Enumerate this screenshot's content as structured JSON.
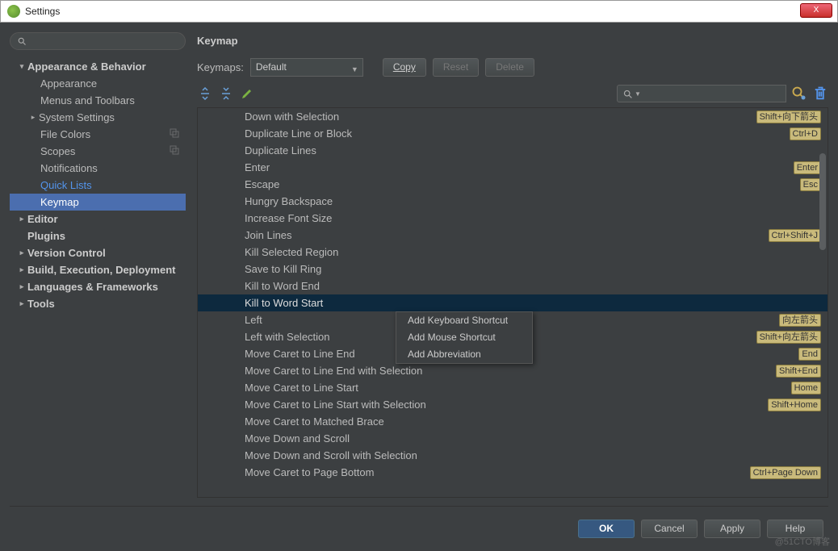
{
  "window": {
    "title": "Settings",
    "close": "X"
  },
  "sidebar": {
    "items": [
      {
        "label": "Appearance & Behavior",
        "lvl": 0,
        "arrow": "▾"
      },
      {
        "label": "Appearance",
        "lvl": 1
      },
      {
        "label": "Menus and Toolbars",
        "lvl": 1
      },
      {
        "label": "System Settings",
        "lvl": "1a",
        "arrow": "▸"
      },
      {
        "label": "File Colors",
        "lvl": 1,
        "copy": true
      },
      {
        "label": "Scopes",
        "lvl": 1,
        "copy": true
      },
      {
        "label": "Notifications",
        "lvl": 1
      },
      {
        "label": "Quick Lists",
        "lvl": 1,
        "link": true
      },
      {
        "label": "Keymap",
        "lvl": 1,
        "selected": true
      },
      {
        "label": "Editor",
        "lvl": 0,
        "arrow": "▸"
      },
      {
        "label": "Plugins",
        "lvl": 0,
        "pad": true
      },
      {
        "label": "Version Control",
        "lvl": 0,
        "arrow": "▸"
      },
      {
        "label": "Build, Execution, Deployment",
        "lvl": 0,
        "arrow": "▸"
      },
      {
        "label": "Languages & Frameworks",
        "lvl": 0,
        "arrow": "▸"
      },
      {
        "label": "Tools",
        "lvl": 0,
        "arrow": "▸"
      }
    ]
  },
  "panel": {
    "title": "Keymap",
    "keymapsLabel": "Keymaps:",
    "keymapsValue": "Default",
    "copy": "Copy",
    "reset": "Reset",
    "delete": "Delete"
  },
  "actions": [
    {
      "name": "Down with Selection",
      "shortcut": "Shift+向下箭头"
    },
    {
      "name": "Duplicate Line or Block",
      "shortcut": "Ctrl+D"
    },
    {
      "name": "Duplicate Lines"
    },
    {
      "name": "Enter",
      "shortcut": "Enter"
    },
    {
      "name": "Escape",
      "shortcut": "Esc"
    },
    {
      "name": "Hungry Backspace"
    },
    {
      "name": "Increase Font Size"
    },
    {
      "name": "Join Lines",
      "shortcut": "Ctrl+Shift+J"
    },
    {
      "name": "Kill Selected Region"
    },
    {
      "name": "Save to Kill Ring"
    },
    {
      "name": "Kill to Word End"
    },
    {
      "name": "Kill to Word Start",
      "selected": true
    },
    {
      "name": "Left",
      "shortcut": "向左箭头"
    },
    {
      "name": "Left with Selection",
      "shortcut": "Shift+向左箭头"
    },
    {
      "name": "Move Caret to Line End",
      "shortcut": "End"
    },
    {
      "name": "Move Caret to Line End with Selection",
      "shortcut": "Shift+End"
    },
    {
      "name": "Move Caret to Line Start",
      "shortcut": "Home"
    },
    {
      "name": "Move Caret to Line Start with Selection",
      "shortcut": "Shift+Home"
    },
    {
      "name": "Move Caret to Matched Brace"
    },
    {
      "name": "Move Down and Scroll"
    },
    {
      "name": "Move Down and Scroll with Selection"
    },
    {
      "name": "Move Caret to Page Bottom",
      "shortcut": "Ctrl+Page Down"
    }
  ],
  "context": {
    "i0": "Add Keyboard Shortcut",
    "i1": "Add Mouse Shortcut",
    "i2": "Add Abbreviation"
  },
  "footer": {
    "ok": "OK",
    "cancel": "Cancel",
    "apply": "Apply",
    "help": "Help"
  },
  "watermark": "@51CTO博客"
}
